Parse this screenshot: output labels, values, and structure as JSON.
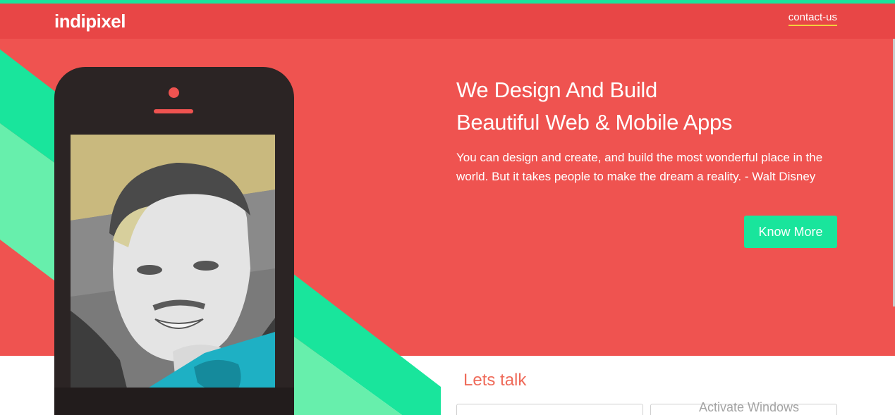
{
  "navbar": {
    "brand": "indipixel",
    "contact_link": "contact-us"
  },
  "hero": {
    "title_line_1": "We Design And Build",
    "title_line_2": "Beautiful Web & Mobile Apps",
    "quote": "You can design and create, and build the most wonderful place in the world. But it takes people to make the dream a reality. - Walt Disney",
    "cta_label": "Know More"
  },
  "contact": {
    "heading": "Lets talk",
    "name_placeholder": "",
    "email_placeholder": ""
  },
  "system": {
    "watermark": "Activate Windows"
  },
  "colors": {
    "brand_red": "#ef5350",
    "nav_red": "#e84646",
    "accent_green": "#19e59c",
    "light_green": "#67efac",
    "heading_coral": "#ef6b5a"
  },
  "icons": {
    "phone": "smartphone-mockup",
    "portrait": "walt-disney-portrait"
  }
}
